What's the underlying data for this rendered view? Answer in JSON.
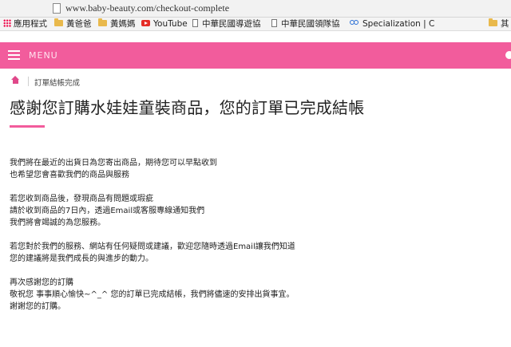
{
  "browser": {
    "url": "www.baby-beauty.com/checkout-complete",
    "bookmarks": [
      {
        "icon": "apps-icon",
        "label": "應用程式"
      },
      {
        "icon": "folder-icon",
        "label": "黃爸爸"
      },
      {
        "icon": "folder-icon",
        "label": "黃媽媽"
      },
      {
        "icon": "youtube-icon",
        "label": "YouTube"
      },
      {
        "icon": "page-icon",
        "label": "中華民國導遊協"
      },
      {
        "icon": "page-icon",
        "label": "中華民國領隊協"
      },
      {
        "icon": "specialization-icon",
        "label": "Specialization | C"
      },
      {
        "icon": "folder-icon",
        "label": "其"
      }
    ]
  },
  "header": {
    "menu_label": "MENU",
    "accent_color": "#f25c9c"
  },
  "breadcrumb": {
    "current": "訂單結帳完成"
  },
  "main": {
    "title": "感謝您訂購水娃娃童裝商品，您的訂單已完成結帳",
    "paragraphs": [
      [
        "我們將在最近的出貨日為您寄出商品，期待您可以早點收到",
        "也希望您會喜歡我們的商品與服務"
      ],
      [
        "若您收到商品後，發現商品有問題或瑕疵",
        "請於收到商品的7日內，透過Email或客服專線通知我們",
        "我們將會竭誠的為您服務。"
      ],
      [
        "若您對於我們的服務、網站有任何疑問或建議，歡迎您隨時透過Email讓我們知道",
        "您的建議將是我們成長的與進步的動力。"
      ],
      [
        "再次感謝您的訂購",
        "敬祝您 事事順心愉快~^_^ 您的訂單已完成結帳，我們將儘速的安排出貨事宜。",
        "謝謝您的訂購。"
      ]
    ]
  }
}
